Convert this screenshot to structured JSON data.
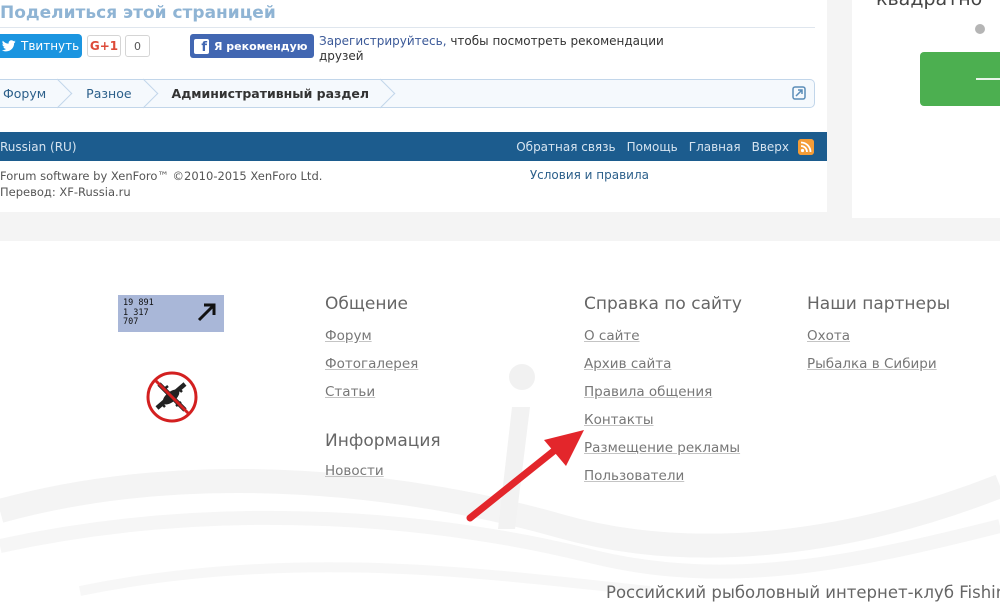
{
  "share": {
    "title": "Поделиться этой страницей",
    "tweet_label": "Твитнуть",
    "gplus_label": "G+1",
    "gplus_count": "0",
    "fb_recommend_label": "Я рекомендую",
    "fb_register_link": "Зарегистрируйтесь,",
    "fb_register_text": " чтобы посмотреть рекомендации друзей"
  },
  "breadcrumb": {
    "items": [
      "Форум",
      "Разное",
      "Административный раздел"
    ]
  },
  "footer_bar": {
    "language": "Russian (RU)",
    "links": [
      "Обратная связь",
      "Помощь",
      "Главная",
      "Вверх"
    ]
  },
  "copyright": {
    "line1": "Forum software by XenForo™ ©2010-2015 XenForo Ltd.",
    "line2": "Перевод: XF-Russia.ru"
  },
  "terms_label": "Условия и правила",
  "sidebar": {
    "partial_text": "квадратно"
  },
  "counter": {
    "line1": "19 891",
    "line2": "1 317",
    "line3": "707"
  },
  "columns": {
    "obshchenie": {
      "title": "Общение",
      "links": [
        "Форум",
        "Фотогалерея",
        "Статьи"
      ]
    },
    "informatsiya": {
      "title": "Информация",
      "links": [
        "Новости"
      ]
    },
    "spravka": {
      "title": "Справка по сайту",
      "links": [
        "О сайте",
        "Архив сайта",
        "Правила общения",
        "Контакты",
        "Размещение рекламы",
        "Пользователи"
      ]
    },
    "partnery": {
      "title": "Наши партнеры",
      "links": [
        "Охота",
        "Рыбалка в Сибири"
      ]
    }
  },
  "bottom_text": "Российский рыболовный интернет-клуб Fishing",
  "colors": {
    "twitter": "#1b95e0",
    "facebook": "#4267b2",
    "footer_bar": "#1c5c8e",
    "rss": "#f49c36",
    "green_button": "#4caf50",
    "annotation_arrow": "#e3262b"
  }
}
